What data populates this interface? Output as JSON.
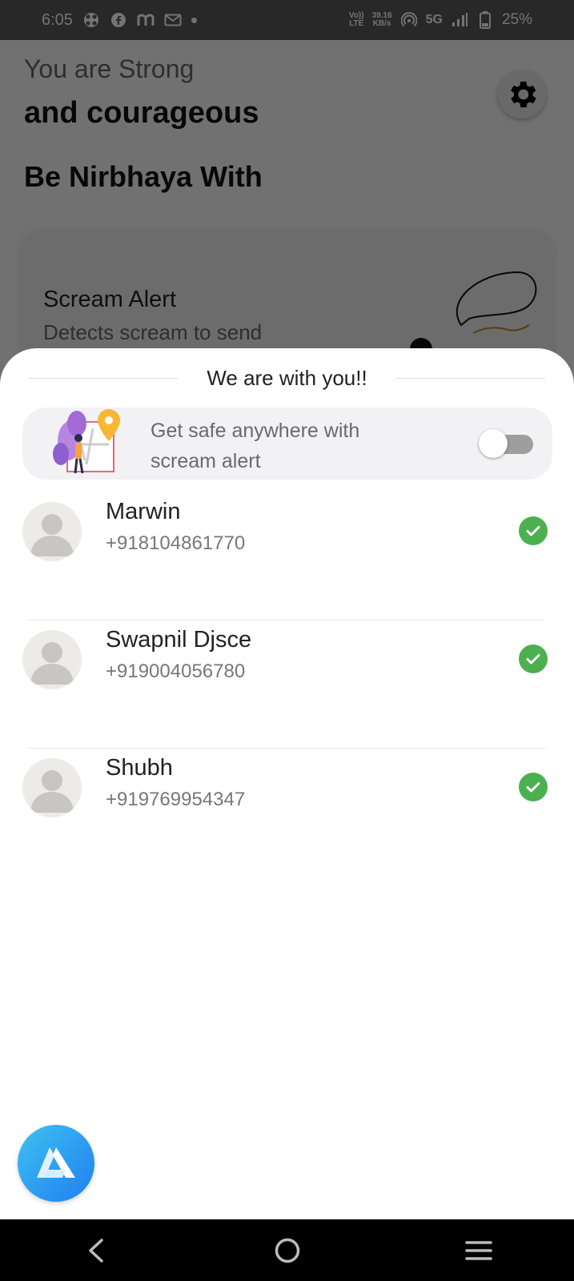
{
  "status_bar": {
    "time": "6:05",
    "network_speed_value": "39.16",
    "network_speed_unit": "KB/s",
    "volte_top": "Vo))",
    "volte_bottom": "LTE",
    "network_type": "5G",
    "battery": "25%"
  },
  "background": {
    "greeting_line1": "You are Strong",
    "greeting_line2": "and courageous",
    "section_title": "Be Nirbhaya With",
    "feature_card": {
      "title": "Scream Alert",
      "description": "Detects scream to send"
    }
  },
  "sheet": {
    "title": "We are with you!!",
    "promo": {
      "text": "Get safe anywhere with scream alert",
      "toggle_on": false
    },
    "contacts": [
      {
        "name": "Marwin",
        "phone": "+918104861770",
        "selected": true
      },
      {
        "name": "Swapnil Djsce",
        "phone": "+919004056780",
        "selected": true
      },
      {
        "name": "Shubh",
        "phone": "+919769954347",
        "selected": true
      }
    ]
  },
  "colors": {
    "accent_check": "#4caf50",
    "fab_gradient_start": "#3fc1f0",
    "fab_gradient_end": "#1e7ff0"
  }
}
